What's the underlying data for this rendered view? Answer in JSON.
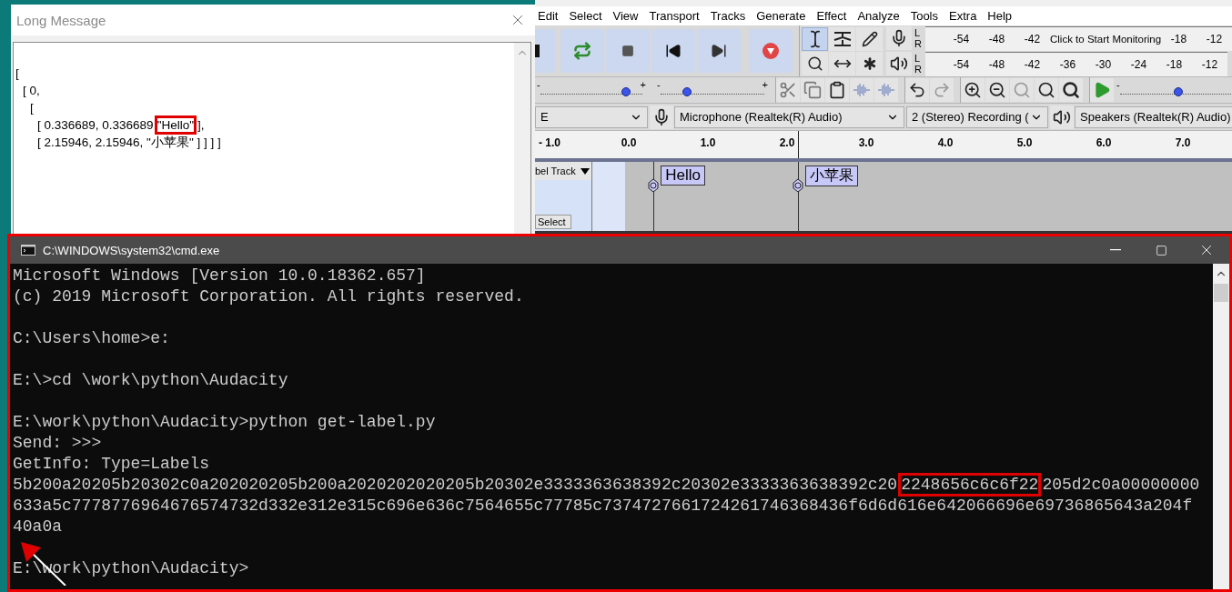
{
  "long_message": {
    "title": "Long Message",
    "lines": [
      {
        "parts": [
          {
            "text": "[",
            "boxed": false
          }
        ]
      },
      {
        "parts": [
          {
            "text": "[ 0,",
            "boxed": false
          }
        ]
      },
      {
        "parts": [
          {
            "text": "[",
            "boxed": false
          }
        ]
      },
      {
        "parts": [
          {
            "text": "[ 0.336689, 0.336689",
            "boxed": false
          },
          {
            "text": "\"Hello\"",
            "boxed": true
          },
          {
            "text": "],",
            "boxed": false
          }
        ]
      },
      {
        "parts": [
          {
            "text": "[ 2.15946, 2.15946, \"小苹果\" ] ] ] ]",
            "boxed": false
          }
        ]
      }
    ]
  },
  "audacity": {
    "menu": [
      "Edit",
      "Select",
      "View",
      "Transport",
      "Tracks",
      "Generate",
      "Effect",
      "Analyze",
      "Tools",
      "Extra",
      "Help"
    ],
    "tools": [
      {
        "selected": true
      },
      {
        "selected": false
      },
      {
        "selected": false
      },
      {
        "selected": false
      },
      {
        "selected": false
      },
      {
        "selected": false
      }
    ],
    "meters": [
      {
        "kind": "record",
        "left": "L",
        "right": "R",
        "scale": [
          "-54",
          "-48",
          "-42"
        ],
        "message": "Click to Start Monitoring",
        "scale_end": [
          "-18",
          "-12"
        ]
      },
      {
        "kind": "playback",
        "left": "L",
        "right": "R",
        "scale": [
          "-54",
          "-48",
          "-42",
          "-36",
          "-30",
          "-24",
          "-18",
          "-12"
        ]
      }
    ],
    "sliders": [
      {
        "minus": "-",
        "plus": "+",
        "level": 0.84
      },
      {
        "minus": "-",
        "plus": "+",
        "level": 0.25
      }
    ],
    "play_at_speed": {
      "minus": "-",
      "level": 0.5
    },
    "devices": {
      "host": "E",
      "recording_device": "Microphone (Realtek(R) Audio)",
      "recording_channels": "2 (Stereo) Recording (",
      "playback_device": "Speakers (Realtek(R) Audio)"
    },
    "timeline": [
      "- 1.0",
      "0.0",
      "1.0",
      "2.0",
      "3.0",
      "4.0",
      "5.0",
      "6.0",
      "7.0"
    ],
    "track": {
      "name": "bel Track",
      "select_button": "Select",
      "labels": [
        {
          "text": "Hello"
        },
        {
          "text": "小苹果"
        }
      ]
    }
  },
  "cmd": {
    "title": "C:\\WINDOWS\\system32\\cmd.exe",
    "lines": [
      {
        "kind": "text",
        "parts": [
          {
            "text": "Microsoft Windows [Version 10.0.18362.657]",
            "boxed": false
          }
        ]
      },
      {
        "kind": "text",
        "parts": [
          {
            "text": "(c) 2019 Microsoft Corporation. All rights reserved.",
            "boxed": false
          }
        ]
      },
      {
        "kind": "blank"
      },
      {
        "kind": "text",
        "parts": [
          {
            "text": "C:\\Users\\home>e:",
            "boxed": false
          }
        ]
      },
      {
        "kind": "blank"
      },
      {
        "kind": "text",
        "parts": [
          {
            "text": "E:\\>cd \\work\\python\\Audacity",
            "boxed": false
          }
        ]
      },
      {
        "kind": "blank"
      },
      {
        "kind": "text",
        "parts": [
          {
            "text": "E:\\work\\python\\Audacity>python get-label.py",
            "boxed": false
          }
        ]
      },
      {
        "kind": "text",
        "parts": [
          {
            "text": "Send: >>>",
            "boxed": false
          }
        ]
      },
      {
        "kind": "text",
        "parts": [
          {
            "text": "GetInfo: Type=Labels",
            "boxed": false
          }
        ]
      },
      {
        "kind": "text",
        "parts": [
          {
            "text": "5b200a20205b20302c0a202020205b200a2020202020205b20302e3333363638392c20302e3333363638392c20",
            "boxed": false
          },
          {
            "text": "2248656c6c6f22",
            "boxed": true
          },
          {
            "text": "205d2c0a00000000",
            "boxed": false
          }
        ]
      },
      {
        "kind": "text",
        "parts": [
          {
            "text": "633a5c7778776964676574732d332e312e315c696e636c7564655c77785c7374727661724261746368436f6d6d616e642066696e69736865643a204f",
            "boxed": false
          }
        ]
      },
      {
        "kind": "text",
        "parts": [
          {
            "text": "40a0a",
            "boxed": false
          }
        ]
      },
      {
        "kind": "blank"
      },
      {
        "kind": "text",
        "parts": [
          {
            "text": "E:\\work\\python\\Audacity>",
            "boxed": false
          }
        ]
      }
    ]
  }
}
